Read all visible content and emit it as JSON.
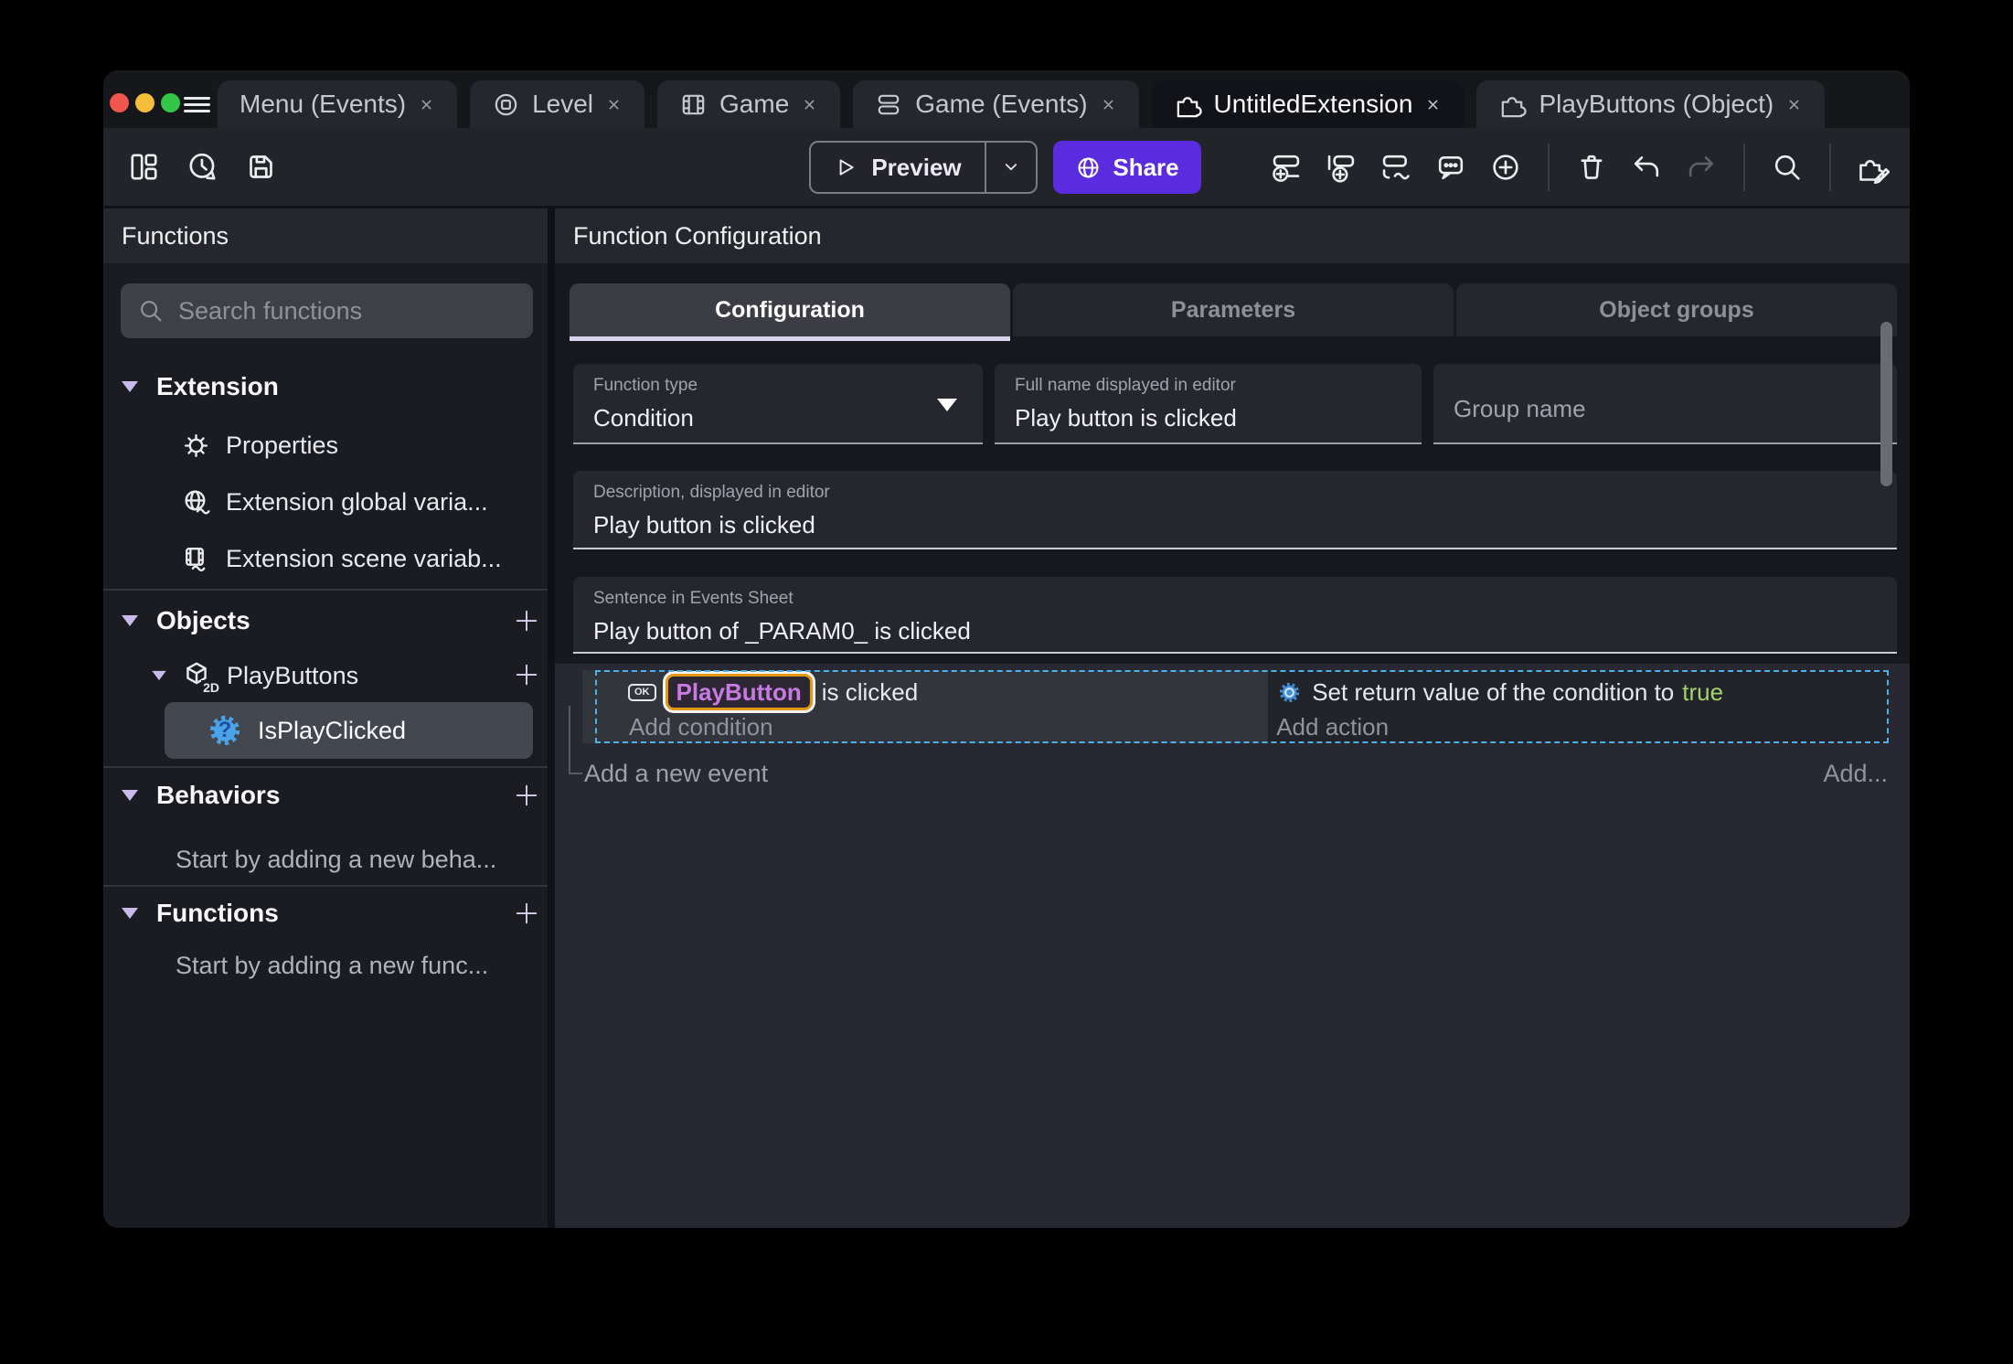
{
  "colors": {
    "accent": "#5b2be0",
    "selection_dash": "#4cb2e8",
    "object_chip_text": "#c77be2",
    "object_chip_border": "#e19a12",
    "true_value": "#a3d16e",
    "icon_blue": "#4aa3e8"
  },
  "titlebar": {
    "tabs": [
      {
        "label": "Menu (Events)",
        "active": false
      },
      {
        "label": "Level",
        "active": false
      },
      {
        "label": "Game",
        "active": false
      },
      {
        "label": "Game (Events)",
        "active": false
      },
      {
        "label": "UntitledExtension",
        "active": true
      },
      {
        "label": "PlayButtons (Object)",
        "active": false
      }
    ]
  },
  "toolbar": {
    "preview_label": "Preview",
    "share_label": "Share"
  },
  "panels": {
    "left_header": "Functions",
    "right_header": "Function Configuration"
  },
  "sidebar": {
    "search_placeholder": "Search functions",
    "extension_header": "Extension",
    "items": [
      {
        "label": "Properties"
      },
      {
        "label": "Extension global varia..."
      },
      {
        "label": "Extension scene variab..."
      }
    ],
    "objects_header": "Objects",
    "object_name": "PlayButtons",
    "object_badge": "2D",
    "selected_function": "IsPlayClicked",
    "function_badge": "?",
    "behaviors_header": "Behaviors",
    "behaviors_empty": "Start by adding a new beha...",
    "functions_header": "Functions",
    "functions_empty": "Start by adding a new func..."
  },
  "config": {
    "tabs": [
      "Configuration",
      "Parameters",
      "Object groups"
    ],
    "function_type": {
      "label": "Function type",
      "value": "Condition"
    },
    "full_name": {
      "label": "Full name displayed in editor",
      "value": "Play button is clicked"
    },
    "group_name": {
      "placeholder": "Group name"
    },
    "description": {
      "label": "Description, displayed in editor",
      "value": "Play button is clicked"
    },
    "sentence": {
      "label": "Sentence in Events Sheet",
      "value": "Play button of _PARAM0_ is clicked"
    }
  },
  "events": {
    "ok_badge": "OK",
    "condition_object": "PlayButton",
    "condition_suffix": "is clicked",
    "add_condition": "Add condition",
    "action_prefix": "Set return value of the condition to",
    "action_value": "true",
    "add_action": "Add action",
    "add_new_event": "Add a new event",
    "add_more": "Add..."
  }
}
